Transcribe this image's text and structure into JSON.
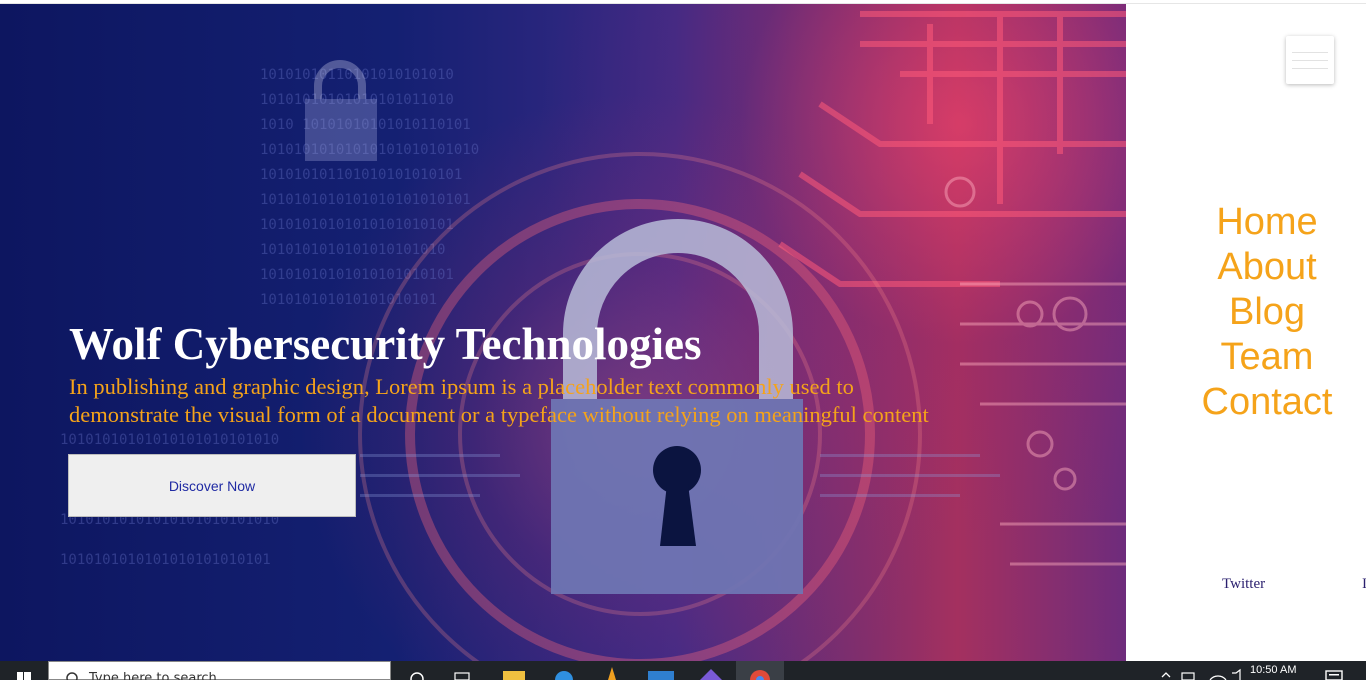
{
  "hero": {
    "title": "Wolf Cybersecurity Technologies",
    "description": "In publishing and graphic design, Lorem ipsum is a placeholder text commonly used to demonstrate the visual form of a document or a typeface without relying on meaningful content",
    "cta_label": "Discover Now"
  },
  "nav": {
    "items": [
      "Home",
      "About",
      "Blog",
      "Team",
      "Contact"
    ]
  },
  "social": {
    "twitter": "Twitter",
    "next": "I"
  },
  "taskbar": {
    "search_placeholder": "Type here to search",
    "clock": "10:50 AM"
  },
  "colors": {
    "accent": "#f5a31a",
    "hero_dark": "#0d1660",
    "hero_red": "#c83a62",
    "taskbar": "#1f2328"
  }
}
